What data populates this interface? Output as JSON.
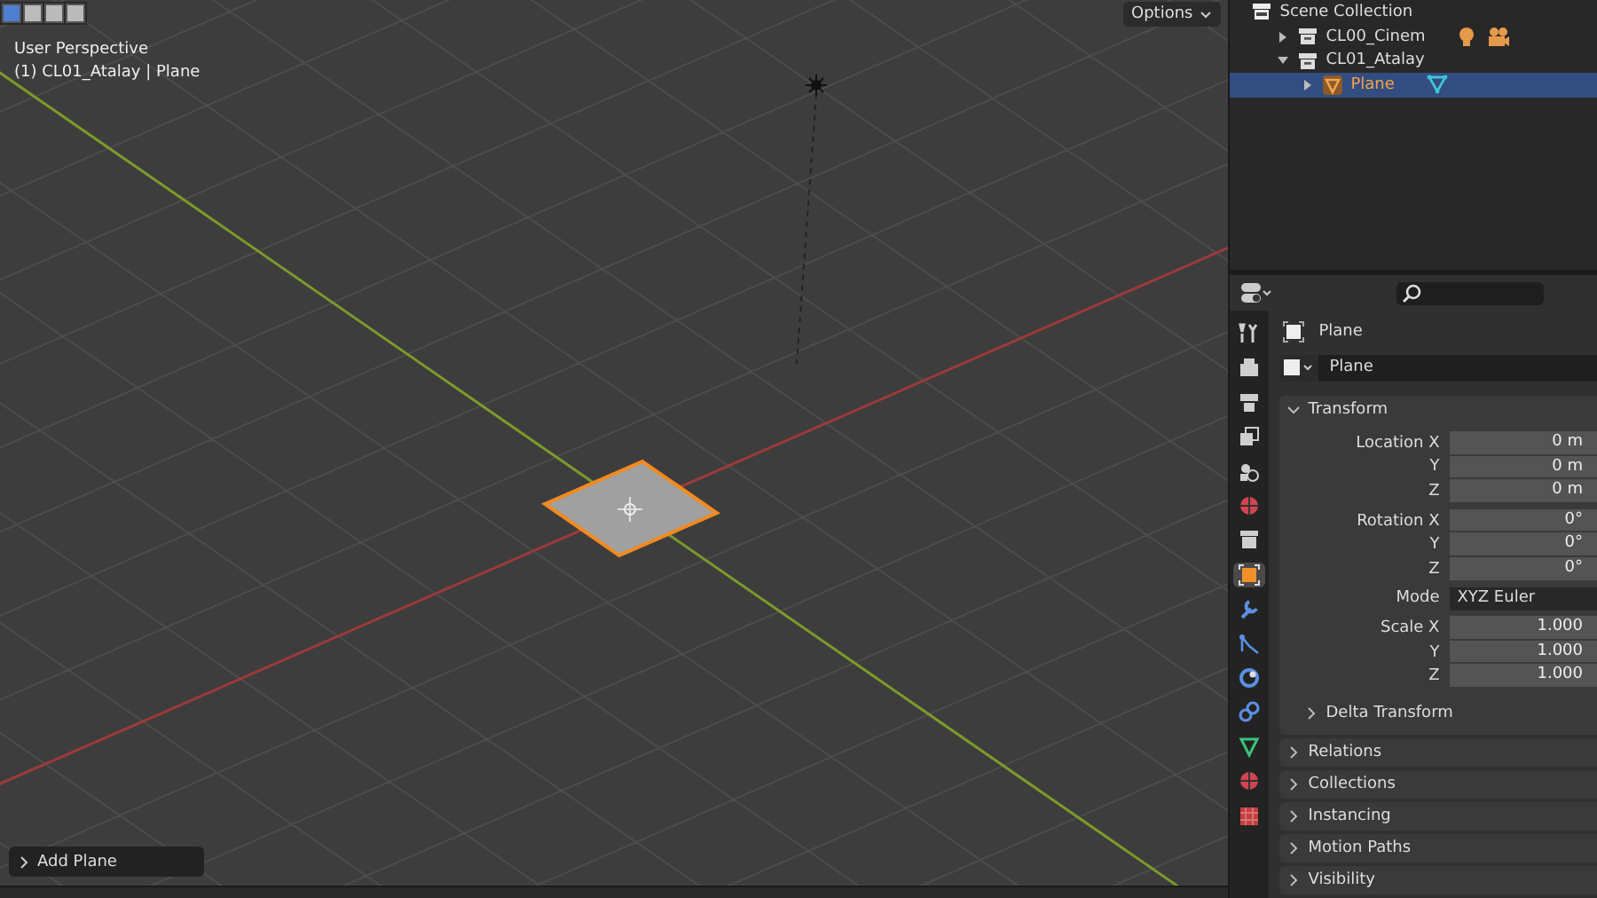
{
  "viewport": {
    "view_name": "User Perspective",
    "context": "(1) CL01_Atalay | Plane",
    "options_label": "Options",
    "last_operator": "Add Plane"
  },
  "outliner": {
    "items": [
      {
        "name": "Scene Collection",
        "kind": "scene",
        "selected": false,
        "children": [
          {
            "name": "CL00_Cinem",
            "kind": "collection",
            "expanded": false,
            "selected": false,
            "extras": [
              {
                "kind": "light"
              },
              {
                "kind": "camera"
              }
            ]
          },
          {
            "name": "CL01_Atalay",
            "kind": "collection",
            "expanded": true,
            "selected": false,
            "children": [
              {
                "name": "Plane",
                "kind": "mesh",
                "expanded": false,
                "selected": true,
                "extras": [
                  {
                    "kind": "mesh_data"
                  }
                ]
              }
            ]
          }
        ]
      }
    ]
  },
  "properties": {
    "tabs": [
      {
        "kind": "tool",
        "selected": false
      },
      {
        "kind": "render",
        "selected": false
      },
      {
        "kind": "output",
        "selected": false
      },
      {
        "kind": "view_layer",
        "selected": false
      },
      {
        "kind": "scene",
        "selected": false
      },
      {
        "kind": "world",
        "selected": false
      },
      {
        "kind": "collection",
        "selected": false
      },
      {
        "kind": "object",
        "selected": true
      },
      {
        "kind": "modifiers",
        "selected": false
      },
      {
        "kind": "particles",
        "selected": false
      },
      {
        "kind": "physics",
        "selected": false
      },
      {
        "kind": "constraints",
        "selected": false
      },
      {
        "kind": "data",
        "selected": false
      },
      {
        "kind": "material",
        "selected": false
      },
      {
        "kind": "texture",
        "selected": false
      }
    ],
    "object_name": "Plane",
    "datablock": "Plane",
    "transform": {
      "title": "Transform",
      "expanded": true,
      "groups": [
        {
          "rows": [
            {
              "label": "Location X",
              "value": "0 m",
              "kind": "number"
            },
            {
              "label": "Y",
              "value": "0 m",
              "kind": "number"
            },
            {
              "label": "Z",
              "value": "0 m",
              "kind": "number"
            }
          ]
        },
        {
          "rows": [
            {
              "label": "Rotation X",
              "value": "0°",
              "kind": "number"
            },
            {
              "label": "Y",
              "value": "0°",
              "kind": "number"
            },
            {
              "label": "Z",
              "value": "0°",
              "kind": "number"
            }
          ]
        },
        {
          "rows": [
            {
              "label": "Mode",
              "value": "XYZ Euler",
              "kind": "dropdown"
            }
          ]
        },
        {
          "rows": [
            {
              "label": "Scale X",
              "value": "1.000",
              "kind": "number"
            },
            {
              "label": "Y",
              "value": "1.000",
              "kind": "number"
            },
            {
              "label": "Z",
              "value": "1.000",
              "kind": "number"
            }
          ]
        }
      ],
      "subpanels": [
        {
          "title": "Delta Transform",
          "expanded": false
        }
      ]
    },
    "panels": [
      {
        "title": "Relations",
        "expanded": false
      },
      {
        "title": "Collections",
        "expanded": false
      },
      {
        "title": "Instancing",
        "expanded": false
      },
      {
        "title": "Motion Paths",
        "expanded": false
      },
      {
        "title": "Visibility",
        "expanded": false
      }
    ]
  }
}
